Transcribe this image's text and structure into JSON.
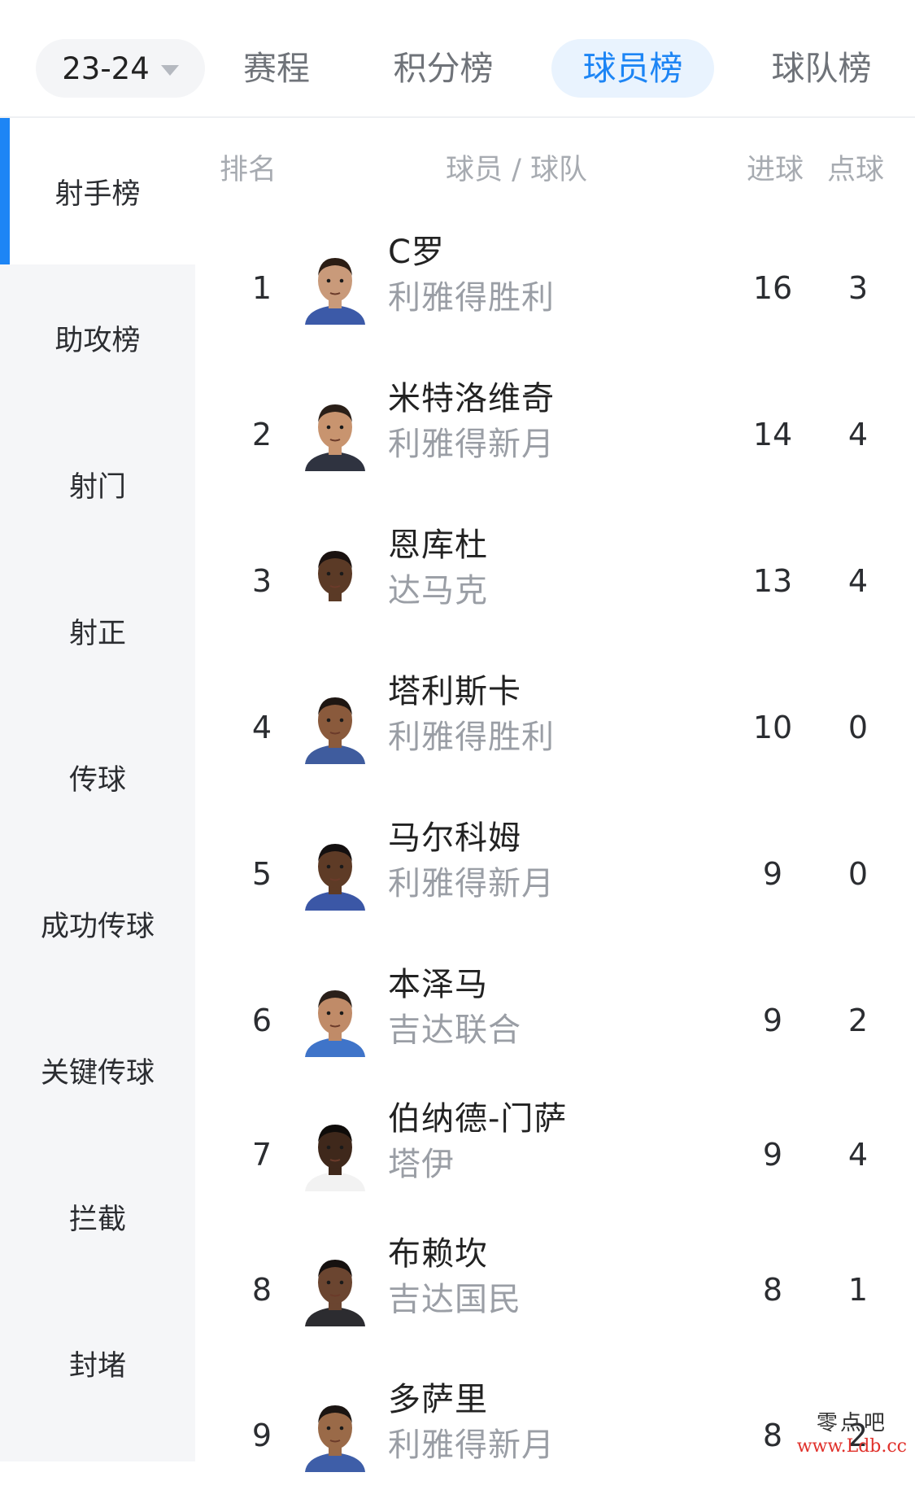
{
  "nav": {
    "season": "23-24",
    "tabs": [
      "赛程",
      "积分榜",
      "球员榜",
      "球队榜"
    ],
    "active_tab": "球员榜"
  },
  "sidebar": {
    "items": [
      "射手榜",
      "助攻榜",
      "射门",
      "射正",
      "传球",
      "成功传球",
      "关键传球",
      "拦截",
      "封堵"
    ],
    "active": "射手榜"
  },
  "table": {
    "headers": {
      "rank": "排名",
      "player_team": "球员 / 球队",
      "goals": "进球",
      "penalties": "点球"
    },
    "rows": [
      {
        "rank": "1",
        "player": "C罗",
        "team": "利雅得胜利",
        "goals": "16",
        "penalties": "3"
      },
      {
        "rank": "2",
        "player": "米特洛维奇",
        "team": "利雅得新月",
        "goals": "14",
        "penalties": "4"
      },
      {
        "rank": "3",
        "player": "恩库杜",
        "team": "达马克",
        "goals": "13",
        "penalties": "4"
      },
      {
        "rank": "4",
        "player": "塔利斯卡",
        "team": "利雅得胜利",
        "goals": "10",
        "penalties": "0"
      },
      {
        "rank": "5",
        "player": "马尔科姆",
        "team": "利雅得新月",
        "goals": "9",
        "penalties": "0"
      },
      {
        "rank": "6",
        "player": "本泽马",
        "team": "吉达联合",
        "goals": "9",
        "penalties": "2"
      },
      {
        "rank": "7",
        "player": "伯纳德-门萨",
        "team": "塔伊",
        "goals": "9",
        "penalties": "4"
      },
      {
        "rank": "8",
        "player": "布赖坎",
        "team": "吉达国民",
        "goals": "8",
        "penalties": "1"
      },
      {
        "rank": "9",
        "player": "多萨里",
        "team": "利雅得新月",
        "goals": "8",
        "penalties": "2"
      }
    ]
  },
  "watermark": {
    "line1": "零点吧",
    "line2": "www.Ldb.cc"
  },
  "colors": {
    "accent": "#1d85f5",
    "active_tab_bg": "#e9f3fe",
    "sidebar_bg": "#f5f6f8",
    "muted_text": "#9a9ea5",
    "watermark_red": "#e0302a"
  }
}
